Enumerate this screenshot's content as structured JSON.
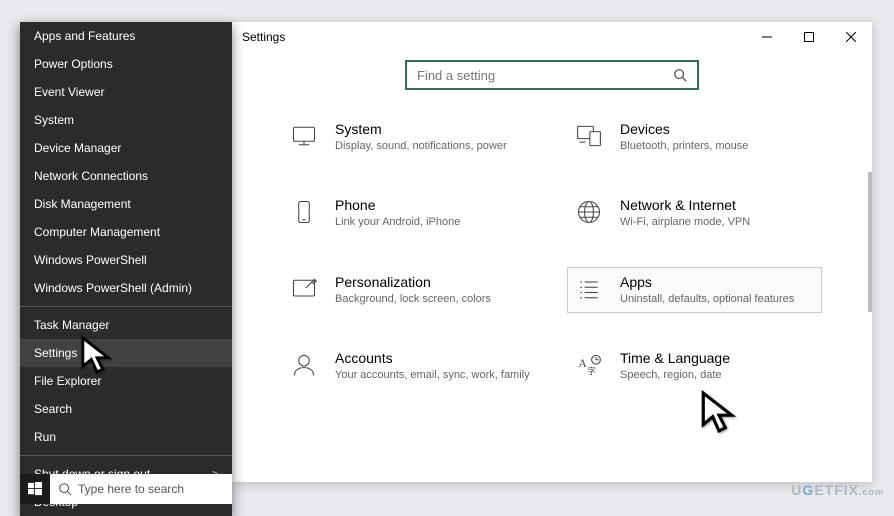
{
  "context_menu": {
    "items_a": [
      "Apps and Features",
      "Power Options",
      "Event Viewer",
      "System",
      "Device Manager",
      "Network Connections",
      "Disk Management",
      "Computer Management",
      "Windows PowerShell",
      "Windows PowerShell (Admin)"
    ],
    "items_b": [
      "Task Manager",
      "Settings",
      "File Explorer",
      "Search",
      "Run"
    ],
    "items_c": [
      "Shut down or sign out",
      "Desktop"
    ],
    "hovered": "Settings",
    "submenu_item": "Shut down or sign out"
  },
  "taskbar": {
    "search_placeholder": "Type here to search"
  },
  "settings_window": {
    "title": "Settings",
    "search_placeholder": "Find a setting",
    "tiles": [
      {
        "id": "system",
        "name": "System",
        "desc": "Display, sound, notifications, power"
      },
      {
        "id": "devices",
        "name": "Devices",
        "desc": "Bluetooth, printers, mouse"
      },
      {
        "id": "phone",
        "name": "Phone",
        "desc": "Link your Android, iPhone"
      },
      {
        "id": "network",
        "name": "Network & Internet",
        "desc": "Wi-Fi, airplane mode, VPN"
      },
      {
        "id": "personalization",
        "name": "Personalization",
        "desc": "Background, lock screen, colors"
      },
      {
        "id": "apps",
        "name": "Apps",
        "desc": "Uninstall, defaults, optional features"
      },
      {
        "id": "accounts",
        "name": "Accounts",
        "desc": "Your accounts, email, sync, work, family"
      },
      {
        "id": "time",
        "name": "Time & Language",
        "desc": "Speech, region, date"
      }
    ],
    "highlighted": "apps"
  },
  "watermark": "UGETFIX"
}
